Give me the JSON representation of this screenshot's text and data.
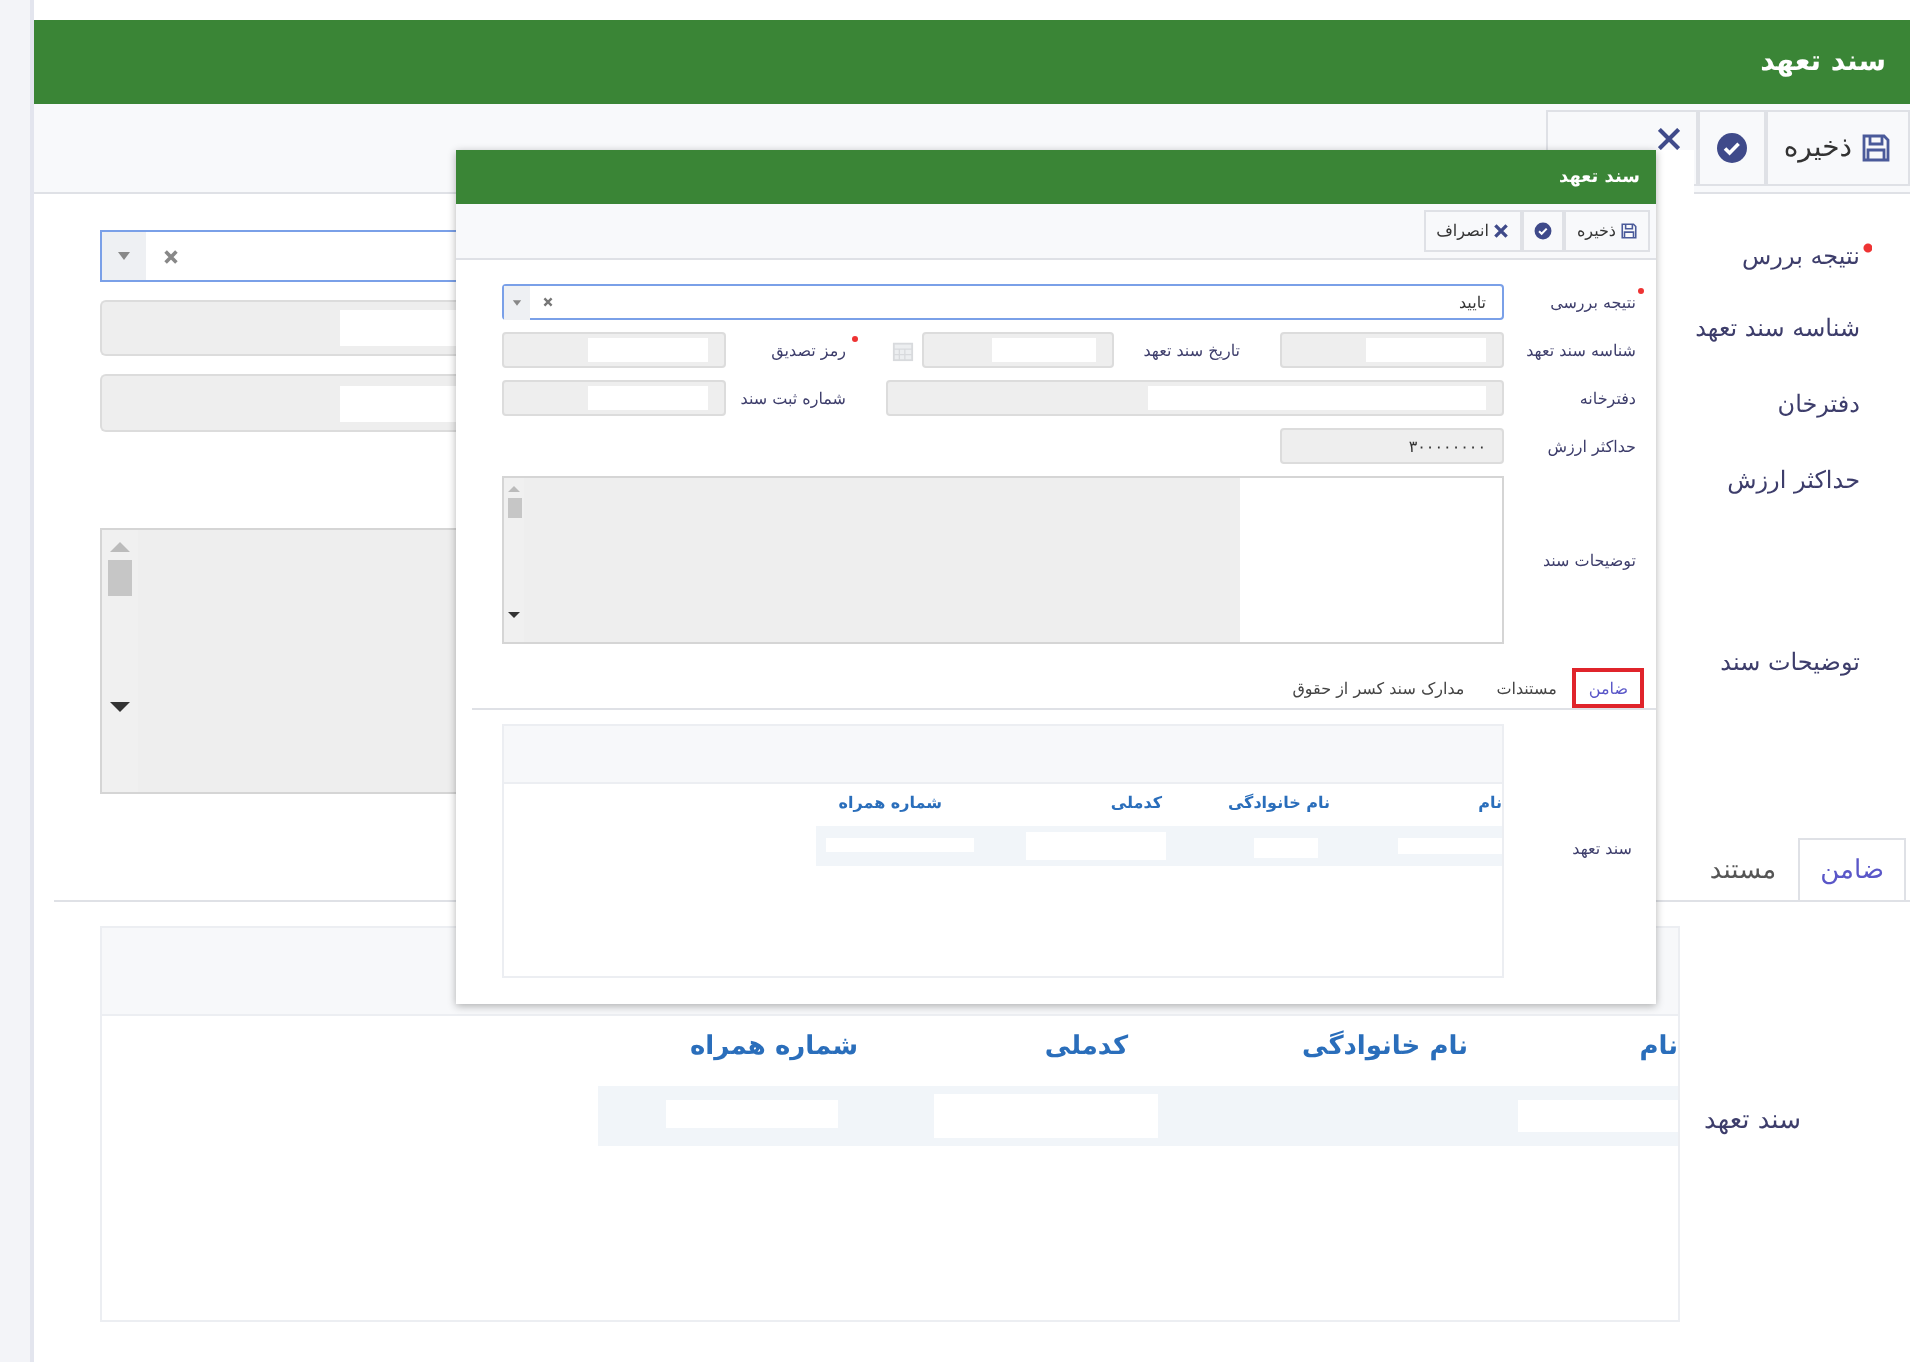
{
  "background_window": {
    "title": "سند تعهد",
    "toolbar": [
      {
        "kind": "save",
        "label": "ذخیره"
      },
      {
        "kind": "confirm"
      },
      {
        "kind": "cancel"
      }
    ],
    "form_rows": [
      {
        "label": "نتیجه بررس",
        "required": true,
        "kind": "select"
      },
      {
        "label": "شناسه سند تعهد",
        "required": false,
        "kind": "text"
      },
      {
        "label": "دفترخان",
        "required": false,
        "kind": "text"
      },
      {
        "label": "حداکثر ارزش",
        "required": false,
        "kind": "hidden"
      },
      {
        "label": "توضیحات سند",
        "required": false,
        "kind": "textarea"
      }
    ],
    "tabs": [
      {
        "label": "ضامن",
        "selected": true
      },
      {
        "label": "مستند",
        "selected": false
      }
    ],
    "grid": {
      "label": "سند تعهد",
      "columns": [
        "نام",
        "نام خانوادگی",
        "کدملی",
        "شماره همراه"
      ]
    }
  },
  "dialog": {
    "title": "سند تعهد",
    "toolbar": [
      {
        "kind": "save",
        "label": "ذخیره"
      },
      {
        "kind": "confirm"
      },
      {
        "kind": "cancel",
        "label": "انصراف"
      }
    ],
    "fields": [
      {
        "label": "نتیجه بررسی",
        "required": true,
        "kind": "select",
        "value": "تایید",
        "disabled": false
      },
      {
        "label": "شناسه سند تعهد",
        "required": false,
        "kind": "text",
        "disabled": true
      },
      {
        "label": "تاریخ سند تعهد",
        "required": false,
        "kind": "date",
        "disabled": true
      },
      {
        "label": "رمز تصدیق",
        "required": true,
        "kind": "text",
        "disabled": true
      },
      {
        "label": "دفترخانه",
        "required": false,
        "kind": "wide",
        "disabled": true
      },
      {
        "label": "شماره ثبت سند",
        "required": false,
        "kind": "text",
        "disabled": true
      },
      {
        "label": "حداکثر ارزش",
        "required": false,
        "kind": "text",
        "value": "۳۰۰۰۰۰۰۰۰",
        "disabled": true
      },
      {
        "label": "توضیحات سند",
        "required": false,
        "kind": "textarea",
        "disabled": true
      }
    ],
    "tabs": [
      {
        "label": "ضامن",
        "selected": true
      },
      {
        "label": "مستندات",
        "selected": false
      },
      {
        "label": "مدارک سند کسر از حقوق",
        "selected": false
      }
    ],
    "grid": {
      "label": "سند تعهد",
      "columns": [
        "نام",
        "نام خانوادگی",
        "کدملی",
        "شماره همراه"
      ]
    }
  }
}
